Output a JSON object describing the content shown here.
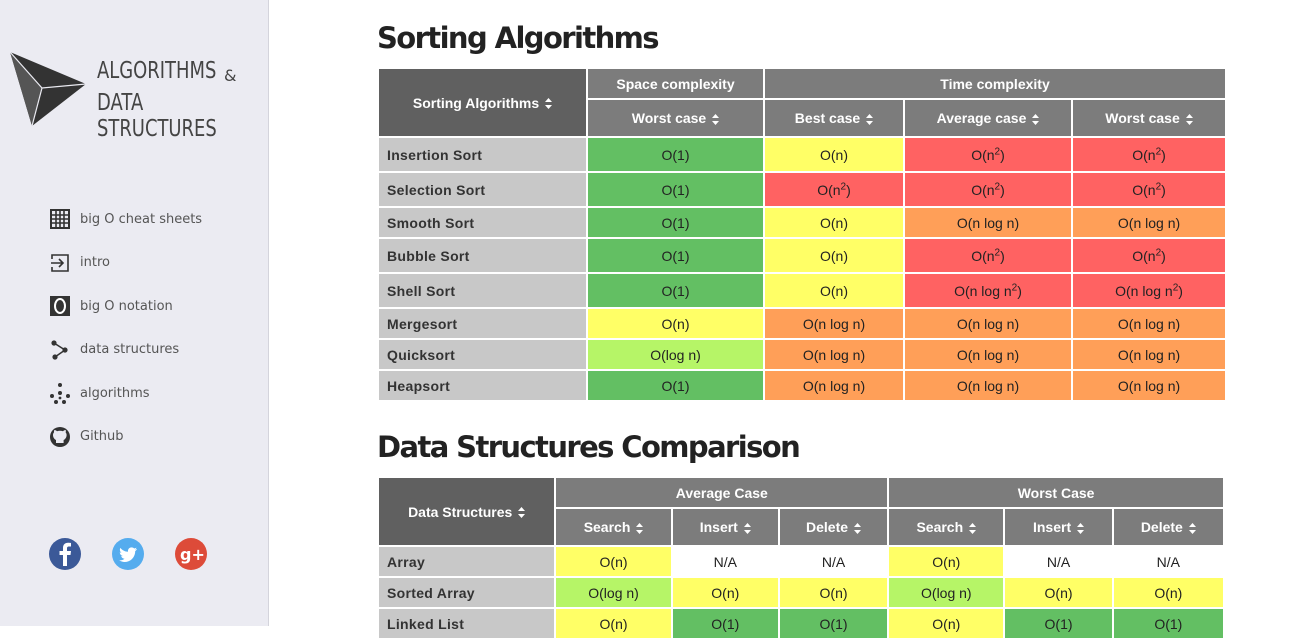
{
  "logo": {
    "line1": "ALGORITHMS",
    "amp": "&",
    "line2": "DATA STRUCTURES"
  },
  "nav": [
    {
      "label": "big O cheat sheets",
      "icon": "grid-icon"
    },
    {
      "label": "intro",
      "icon": "enter-icon"
    },
    {
      "label": "big O notation",
      "icon": "big-o-icon"
    },
    {
      "label": "data structures",
      "icon": "share-nodes-icon"
    },
    {
      "label": "algorithms",
      "icon": "cluster-icon"
    },
    {
      "label": "Github",
      "icon": "github-icon"
    }
  ],
  "social": [
    {
      "icon": "facebook-icon",
      "color": "#3b5998",
      "glyph": "f"
    },
    {
      "icon": "twitter-icon",
      "color": "#55acee",
      "glyph": ""
    },
    {
      "icon": "google-plus-icon",
      "color": "#dd4b39",
      "glyph": "g+"
    }
  ],
  "colors": {
    "green": "#63bf63",
    "yellow": "#ffff66",
    "lime": "#b6f567",
    "orange": "#ff9f58",
    "red": "#ff6262",
    "header": "#7c7c7c",
    "rowhead": "#c8c8c8"
  },
  "sorting": {
    "title": "Sorting Algorithms",
    "corner": "Sorting Algorithms",
    "groups": [
      "Space complexity",
      "Time complexity"
    ],
    "columns": [
      "Worst case",
      "Best case",
      "Average case",
      "Worst case"
    ],
    "rows": [
      {
        "name": "Insertion Sort",
        "cells": [
          {
            "b": "O(1)",
            "s": "",
            "a": "",
            "c": "green"
          },
          {
            "b": "O(n)",
            "s": "",
            "a": "",
            "c": "yellow"
          },
          {
            "b": "O(n",
            "s": "2",
            "a": ")",
            "c": "red"
          },
          {
            "b": "O(n",
            "s": "2",
            "a": ")",
            "c": "red"
          }
        ]
      },
      {
        "name": "Selection Sort",
        "cells": [
          {
            "b": "O(1)",
            "s": "",
            "a": "",
            "c": "green"
          },
          {
            "b": "O(n",
            "s": "2",
            "a": ")",
            "c": "red"
          },
          {
            "b": "O(n",
            "s": "2",
            "a": ")",
            "c": "red"
          },
          {
            "b": "O(n",
            "s": "2",
            "a": ")",
            "c": "red"
          }
        ]
      },
      {
        "name": "Smooth Sort",
        "cells": [
          {
            "b": "O(1)",
            "s": "",
            "a": "",
            "c": "green"
          },
          {
            "b": "O(n)",
            "s": "",
            "a": "",
            "c": "yellow"
          },
          {
            "b": "O(n log n)",
            "s": "",
            "a": "",
            "c": "orange"
          },
          {
            "b": "O(n log n)",
            "s": "",
            "a": "",
            "c": "orange"
          }
        ]
      },
      {
        "name": "Bubble Sort",
        "cells": [
          {
            "b": "O(1)",
            "s": "",
            "a": "",
            "c": "green"
          },
          {
            "b": "O(n)",
            "s": "",
            "a": "",
            "c": "yellow"
          },
          {
            "b": "O(n",
            "s": "2",
            "a": ")",
            "c": "red"
          },
          {
            "b": "O(n",
            "s": "2",
            "a": ")",
            "c": "red"
          }
        ]
      },
      {
        "name": "Shell Sort",
        "cells": [
          {
            "b": "O(1)",
            "s": "",
            "a": "",
            "c": "green"
          },
          {
            "b": "O(n)",
            "s": "",
            "a": "",
            "c": "yellow"
          },
          {
            "b": "O(n log n",
            "s": "2",
            "a": ")",
            "c": "red"
          },
          {
            "b": "O(n log n",
            "s": "2",
            "a": ")",
            "c": "red"
          }
        ]
      },
      {
        "name": "Mergesort",
        "cells": [
          {
            "b": "O(n)",
            "s": "",
            "a": "",
            "c": "yellow"
          },
          {
            "b": "O(n log n)",
            "s": "",
            "a": "",
            "c": "orange"
          },
          {
            "b": "O(n log n)",
            "s": "",
            "a": "",
            "c": "orange"
          },
          {
            "b": "O(n log n)",
            "s": "",
            "a": "",
            "c": "orange"
          }
        ]
      },
      {
        "name": "Quicksort",
        "cells": [
          {
            "b": "O(log n)",
            "s": "",
            "a": "",
            "c": "lime"
          },
          {
            "b": "O(n log n)",
            "s": "",
            "a": "",
            "c": "orange"
          },
          {
            "b": "O(n log n)",
            "s": "",
            "a": "",
            "c": "orange"
          },
          {
            "b": "O(n log n)",
            "s": "",
            "a": "",
            "c": "orange"
          }
        ]
      },
      {
        "name": "Heapsort",
        "cells": [
          {
            "b": "O(1)",
            "s": "",
            "a": "",
            "c": "green"
          },
          {
            "b": "O(n log n)",
            "s": "",
            "a": "",
            "c": "orange"
          },
          {
            "b": "O(n log n)",
            "s": "",
            "a": "",
            "c": "orange"
          },
          {
            "b": "O(n log n)",
            "s": "",
            "a": "",
            "c": "orange"
          }
        ]
      }
    ]
  },
  "ds": {
    "title": "Data Structures Comparison",
    "corner": "Data Structures",
    "groups": [
      "Average Case",
      "Worst Case"
    ],
    "columns": [
      "Search",
      "Insert",
      "Delete",
      "Search",
      "Insert",
      "Delete"
    ],
    "rows": [
      {
        "name": "Array",
        "cells": [
          {
            "b": "O(n)",
            "c": "yellow"
          },
          {
            "b": "N/A",
            "c": "white"
          },
          {
            "b": "N/A",
            "c": "white"
          },
          {
            "b": "O(n)",
            "c": "yellow"
          },
          {
            "b": "N/A",
            "c": "white"
          },
          {
            "b": "N/A",
            "c": "white"
          }
        ]
      },
      {
        "name": "Sorted Array",
        "cells": [
          {
            "b": "O(log n)",
            "c": "lime"
          },
          {
            "b": "O(n)",
            "c": "yellow"
          },
          {
            "b": "O(n)",
            "c": "yellow"
          },
          {
            "b": "O(log n)",
            "c": "lime"
          },
          {
            "b": "O(n)",
            "c": "yellow"
          },
          {
            "b": "O(n)",
            "c": "yellow"
          }
        ]
      },
      {
        "name": "Linked List",
        "cells": [
          {
            "b": "O(n)",
            "c": "yellow"
          },
          {
            "b": "O(1)",
            "c": "green"
          },
          {
            "b": "O(1)",
            "c": "green"
          },
          {
            "b": "O(n)",
            "c": "yellow"
          },
          {
            "b": "O(1)",
            "c": "green"
          },
          {
            "b": "O(1)",
            "c": "green"
          }
        ]
      }
    ]
  }
}
